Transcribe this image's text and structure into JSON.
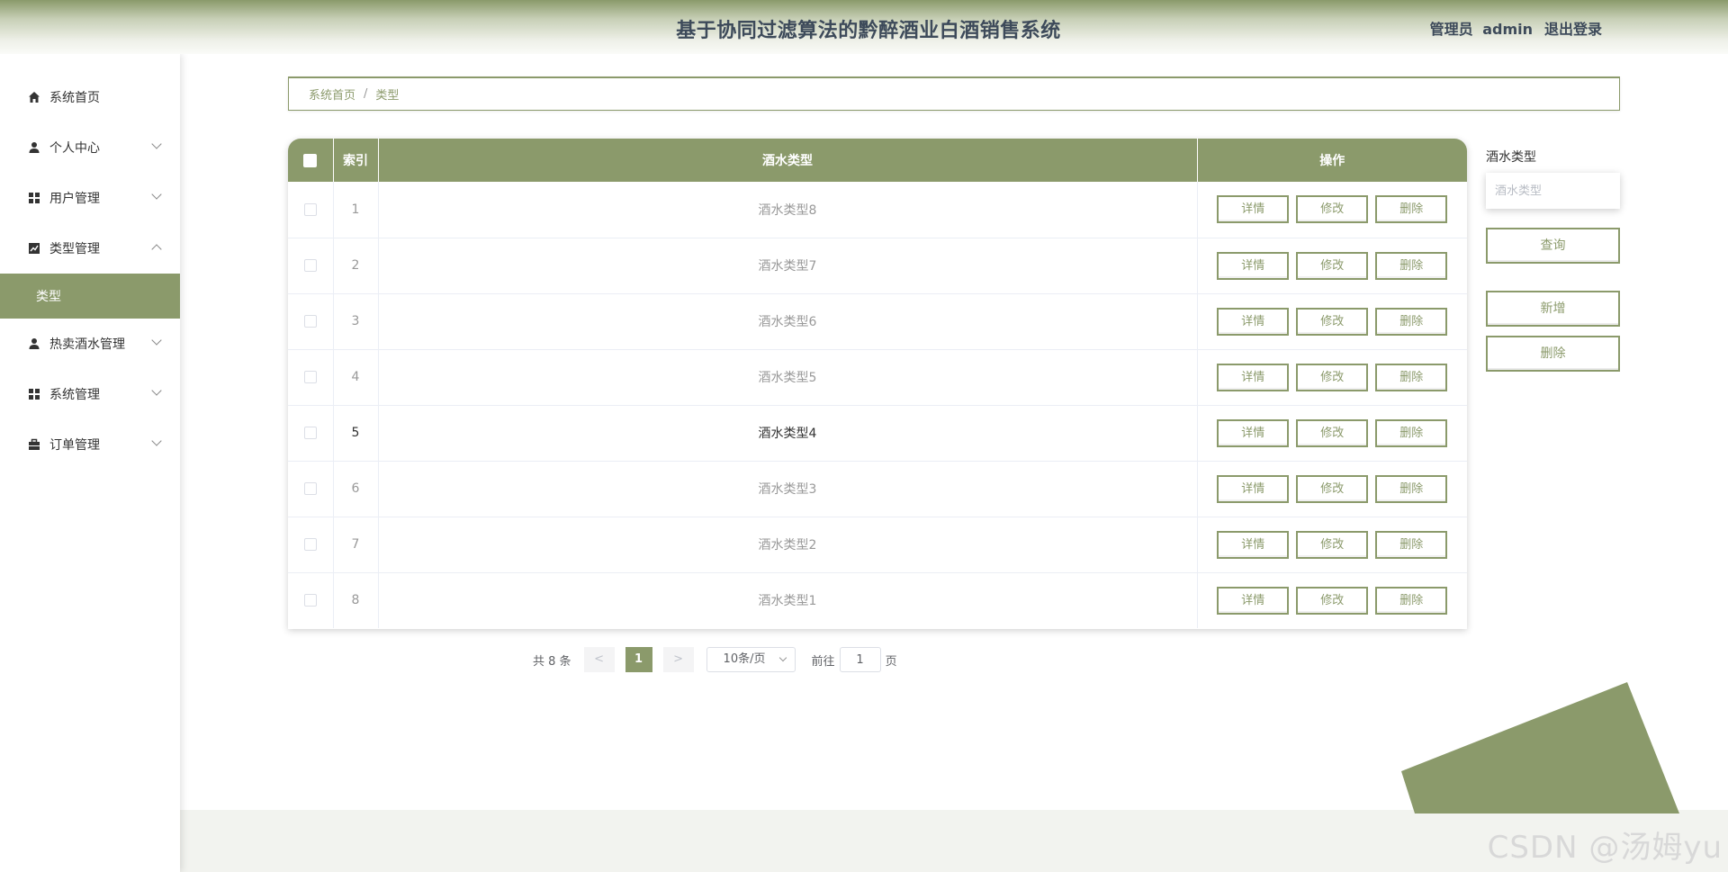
{
  "header": {
    "title": "基于协同过滤算法的黔醉酒业白酒销售系统",
    "user_role": "管理员",
    "user_name": "admin",
    "logout_label": "退出登录"
  },
  "sidebar": {
    "items": [
      {
        "label": "系统首页",
        "icon": "home-icon"
      },
      {
        "label": "个人中心",
        "icon": "user-icon"
      },
      {
        "label": "用户管理",
        "icon": "grid-icon"
      },
      {
        "label": "类型管理",
        "icon": "chart-icon"
      },
      {
        "label": "热卖酒水管理",
        "icon": "user-icon"
      },
      {
        "label": "系统管理",
        "icon": "grid-icon"
      },
      {
        "label": "订单管理",
        "icon": "briefcase-icon"
      }
    ],
    "active_sub": "类型"
  },
  "breadcrumb": {
    "home": "系统首页",
    "sep": "/",
    "current": "类型"
  },
  "table": {
    "headers": {
      "index": "索引",
      "type": "酒水类型",
      "ops": "操作"
    },
    "rows": [
      {
        "index": "1",
        "type": "酒水类型8"
      },
      {
        "index": "2",
        "type": "酒水类型7"
      },
      {
        "index": "3",
        "type": "酒水类型6"
      },
      {
        "index": "4",
        "type": "酒水类型5"
      },
      {
        "index": "5",
        "type": "酒水类型4"
      },
      {
        "index": "6",
        "type": "酒水类型3"
      },
      {
        "index": "7",
        "type": "酒水类型2"
      },
      {
        "index": "8",
        "type": "酒水类型1"
      }
    ],
    "btn_detail": "详情",
    "btn_edit": "修改",
    "btn_delete": "删除"
  },
  "search": {
    "label": "酒水类型",
    "placeholder": "酒水类型",
    "query_label": "查询",
    "add_label": "新增",
    "delete_label": "删除"
  },
  "pagination": {
    "total": "共 8 条",
    "prev": "<",
    "current": "1",
    "next": ">",
    "page_size": "10条/页",
    "goto_label": "前往",
    "goto_value": "1",
    "page_suffix": "页"
  },
  "watermark": "CSDN @汤姆yu",
  "colors": {
    "accent": "#8b9a6b",
    "title": "#3d4a5a"
  }
}
